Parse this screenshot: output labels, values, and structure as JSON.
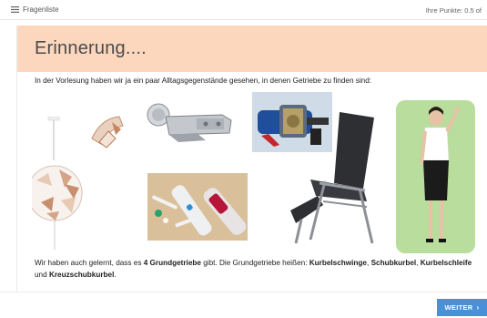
{
  "topbar": {
    "question_list_label": "Fragenliste",
    "points_label": "Ihre Punkte: 0.5 of",
    "list_icon": "list-icon"
  },
  "card": {
    "title": "Erinnerung....",
    "intro": "In der Vorlesung haben wir ja ein paar Alltagsgegenstände gesehen, in denen Getriebe zu finden sind:",
    "summary": {
      "p1": "Wir haben auch gelernt, dass es ",
      "b1": "4 Grundgetriebe",
      "p2": " gibt. Die Grundgetriebe heißen: ",
      "b2": "Kurbelschwinge",
      "p3": ", ",
      "b3": "Schubkurbel",
      "p4": ", ",
      "b4": "Kurbelschleife",
      "p5": " und ",
      "b5": "Kreuzschubkurbel",
      "p6": "."
    },
    "images": [
      "pendant-lamp-image",
      "lamp-detail-image",
      "cabinet-hinge-image",
      "jigsaw-mechanism-image",
      "electric-toothbrush-image",
      "reclining-chair-image",
      "person-waving-image"
    ]
  },
  "footer": {
    "next_label": "WEITER",
    "next_icon": "chevron-right-icon"
  },
  "colors": {
    "banner": "#fcd7bd",
    "button": "#4a90d9"
  }
}
